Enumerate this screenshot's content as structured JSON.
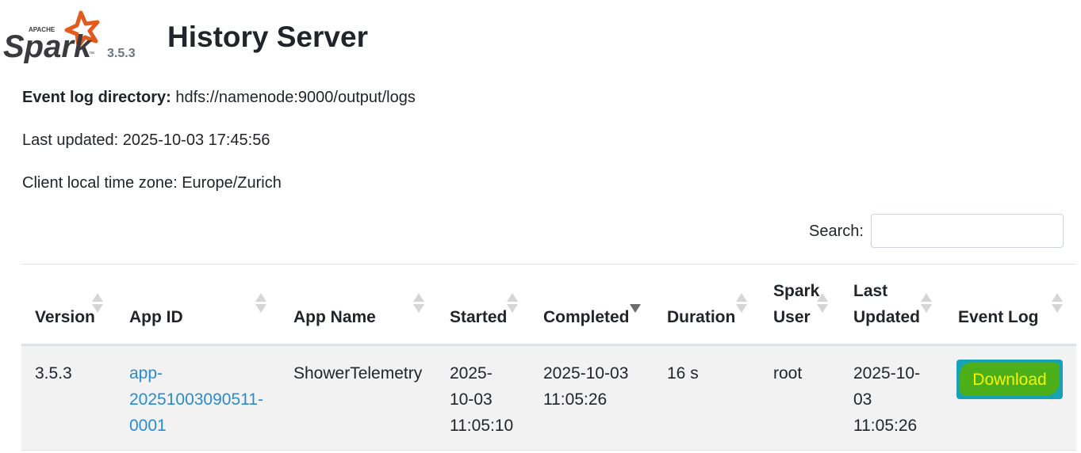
{
  "header": {
    "logo_small_text": "APACHE",
    "logo_text": "Spark",
    "logo_tm": "™",
    "version": "3.5.3",
    "title": "History Server"
  },
  "info": {
    "event_log_label": "Event log directory:",
    "event_log_value": "hdfs://namenode:9000/output/logs",
    "last_updated": "Last updated: 2025-10-03 17:45:56",
    "timezone": "Client local time zone: Europe/Zurich"
  },
  "search": {
    "label": "Search:",
    "value": "",
    "placeholder": ""
  },
  "table": {
    "columns": [
      "Version",
      "App ID",
      "App Name",
      "Started",
      "Completed",
      "Duration",
      "Spark",
      "User",
      "Last",
      "Updated",
      "Event Log"
    ],
    "sorted_column": "Completed",
    "sort_direction": "descending",
    "rows": [
      {
        "version": "3.5.3",
        "app_id_1": "app-",
        "app_id_2": "20251003090511-",
        "app_id_3": "0001",
        "app_name": "ShowerTelemetry",
        "started_1": "2025-",
        "started_2": "10-03",
        "started_3": "11:05:10",
        "completed_1": "2025-10-03",
        "completed_2": "11:05:26",
        "duration": "16 s",
        "user": "root",
        "last_updated_1": "2025-10-",
        "last_updated_2": "03",
        "last_updated_3": "11:05:26",
        "event_log": "Download"
      }
    ]
  },
  "colors": {
    "link": "#2a8bce",
    "button": "#17a2b8",
    "highlight": "#4caf1a",
    "logo_orange": "#e25a1c"
  }
}
